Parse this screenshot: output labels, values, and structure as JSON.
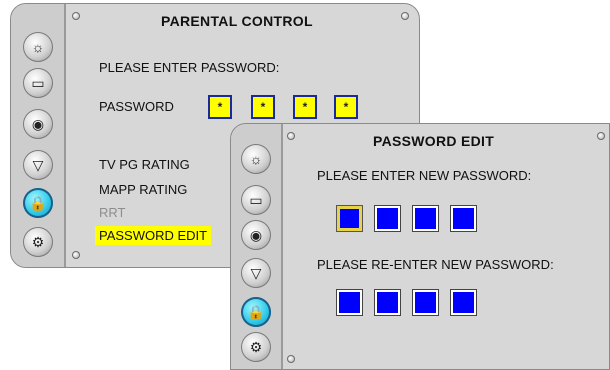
{
  "parental": {
    "title": "PARENTAL CONTROL",
    "prompt": "PLEASE ENTER PASSWORD:",
    "password_label": "PASSWORD",
    "password_chars": [
      "*",
      "*",
      "*",
      "*"
    ],
    "menu": [
      "TV PG RATING",
      "MAPP RATING",
      "RRT",
      "PASSWORD EDIT"
    ]
  },
  "password_edit": {
    "title": "PASSWORD EDIT",
    "new_prompt": "PLEASE ENTER NEW PASSWORD:",
    "reenter_prompt": "PLEASE RE-ENTER NEW PASSWORD:"
  },
  "icons": [
    "picture-icon",
    "tv-icon",
    "speaker-icon",
    "channel-icon",
    "lock-icon",
    "setup-icon"
  ],
  "active_icon": "lock-icon",
  "colors": {
    "highlight": "#ffff00",
    "input_box": "#0000ff",
    "active_icon": "#2ec9e8"
  }
}
